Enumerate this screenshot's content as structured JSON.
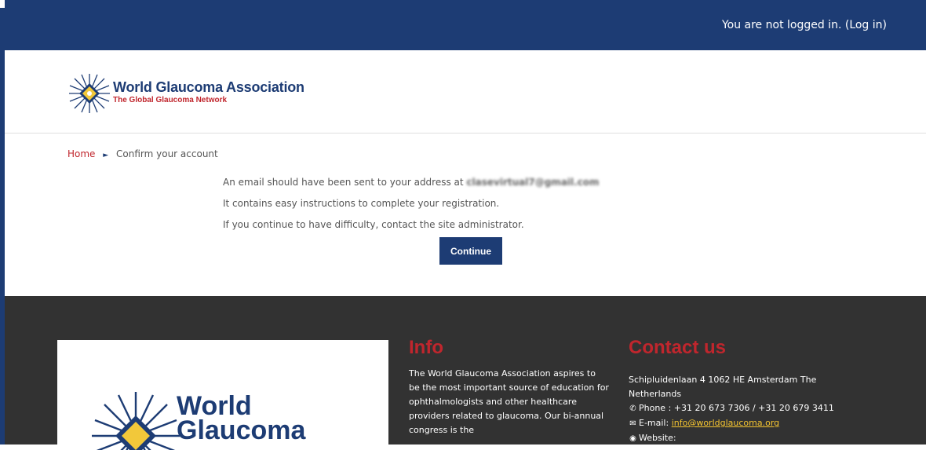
{
  "topbar": {
    "login_status": "You are not logged in. (",
    "login_link": "Log in",
    "login_close": ")"
  },
  "header": {
    "logo_title": "World Glaucoma Association",
    "logo_subtitle": "The Global Glaucoma Network"
  },
  "breadcrumb": {
    "home": "Home",
    "separator": "►",
    "current": "Confirm your account"
  },
  "confirmation": {
    "line1_prefix": "An email should have been sent to your address at ",
    "email": "clasevirtual7@gmail.com",
    "line2": "It contains easy instructions to complete your registration.",
    "line3": "If you continue to have difficulty, contact the site administrator.",
    "continue_label": "Continue"
  },
  "footer": {
    "logo_line1": "World",
    "logo_line2": "Glaucoma",
    "info_title": "Info",
    "info_text": "The World Glaucoma Association aspires to be the most important source of education for ophthalmologists and other healthcare providers related to glaucoma. Our bi-annual congress is the",
    "contact_title": "Contact us",
    "address": "Schipluidenlaan 4 1062 HE Amsterdam The Netherlands",
    "phone_label": "Phone : ",
    "phone_value": "+31 20 673 7306 / +31 20 679 3411",
    "email_label": "E-mail: ",
    "email_value": "info@worldglaucoma.org",
    "website_label": "Website:"
  },
  "colors": {
    "primary": "#1d3c74",
    "accent": "#c0262d",
    "footer_bg": "#323232",
    "email_highlight": "#f4c430"
  },
  "icons": {
    "phone": "phone-icon",
    "email": "envelope-icon",
    "website": "globe-icon",
    "breadcrumb_separator": "triangle-right-icon"
  }
}
